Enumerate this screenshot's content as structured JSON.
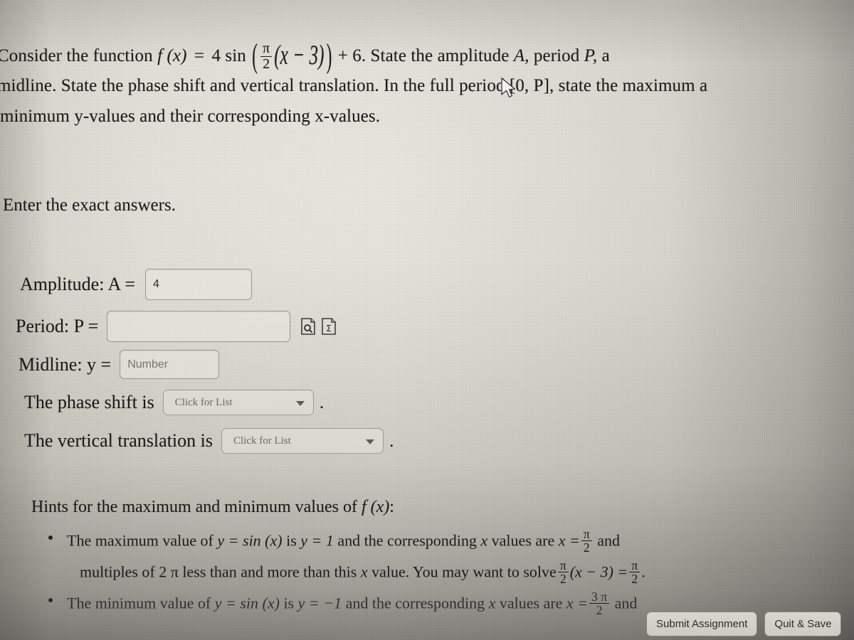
{
  "problem": {
    "line1_pre": "Consider the function",
    "fx": "f (x)",
    "equals": "=",
    "coef": "4 sin",
    "frac_num": "π",
    "frac_den": "2",
    "inner": "(x − 3)",
    "plus_c": "+ 6.",
    "line1_post": "State the amplitude",
    "var_A": "A,",
    "word_period": "period",
    "var_P": "P,",
    "line1_tail": "a",
    "line2": "midline. State the phase shift and vertical translation. In the full period [0, P], state the maximum a",
    "line3": "minimum y-values and their corresponding x-values.",
    "enter_exact": "Enter the exact answers."
  },
  "fields": {
    "amplitude_label": "Amplitude: A =",
    "amplitude_value": "4",
    "period_label": "Period: P =",
    "period_value": "",
    "midline_label": "Midline: y =",
    "midline_placeholder": "Number",
    "midline_value": "",
    "phase_shift_label": "The phase shift is",
    "phase_shift_selected": "Click for List",
    "vertical_translation_label": "The vertical translation is",
    "vertical_translation_selected": "Click for List",
    "trailing_period": ".",
    "preview_icon": "document-magnifier-icon",
    "math_icon": "document-sigma-icon"
  },
  "hints": {
    "title_pre": "Hints for the maximum and minimum values of",
    "title_fx": "f (x)",
    "title_colon": ":",
    "b1_a": "The maximum value of",
    "b1_y": "y = sin (x)",
    "b1_b": "is",
    "b1_y1": "y = 1",
    "b1_c": "and the corresponding",
    "b1_x": "x",
    "b1_d": "values are",
    "b1_xeq": "x =",
    "b1_frac_num": "π",
    "b1_frac_den": "2",
    "b1_and": "and",
    "b1_line2_a": "multiples of 2 π less than and more than this",
    "b1_line2_x": "x",
    "b1_line2_b": "value. You may want to solve",
    "b1_solve_num": "π",
    "b1_solve_den": "2",
    "b1_solve_expr": "(x − 3) =",
    "b1_rhs_num": "π",
    "b1_rhs_den": "2",
    "b1_dot": ".",
    "b2_a": "The minimum value of",
    "b2_y": "y = sin (x)",
    "b2_b": "is",
    "b2_ym1": "y = −1",
    "b2_c": "and the corresponding",
    "b2_x": "x",
    "b2_d": "values are",
    "b2_xeq": "x =",
    "b2_frac_num": "3 π",
    "b2_frac_den": "2",
    "b2_and": "and"
  },
  "buttons": {
    "submit": "Submit Assignment",
    "quit_save": "Quit & Save"
  },
  "colors": {
    "page_background": "#e3e0d7",
    "text": "#1a1a1a",
    "field_border": "#9a988f",
    "button_face": "#d2cfc6"
  }
}
